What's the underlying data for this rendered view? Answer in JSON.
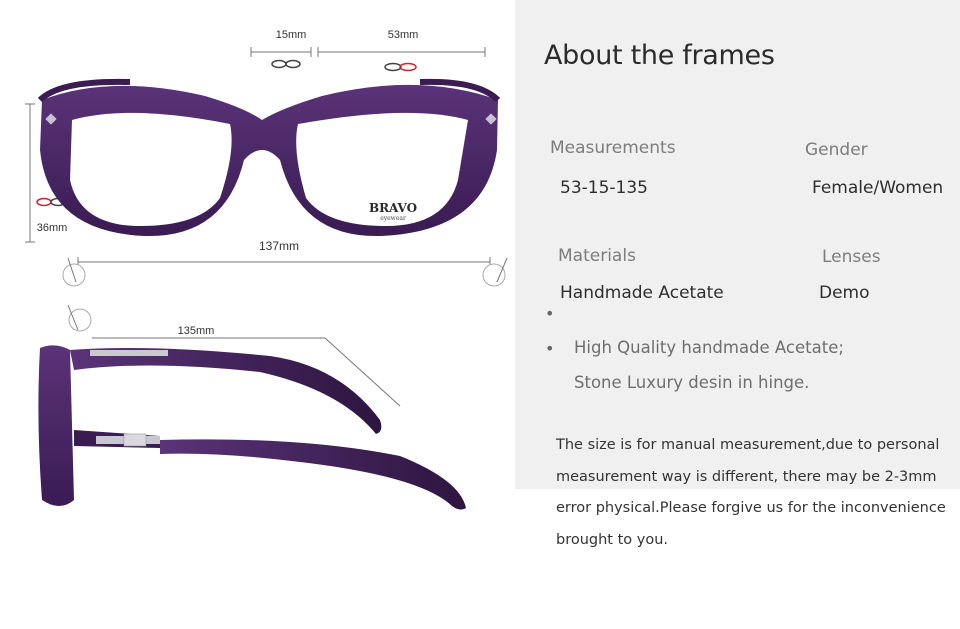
{
  "measurements_diagram": {
    "bridge_width": "15mm",
    "lens_width": "53mm",
    "lens_height": "36mm",
    "frame_width": "137mm",
    "temple_length": "135mm",
    "brand_logo": "BRAVO",
    "brand_sub": "eyewear"
  },
  "info": {
    "title": "About the frames",
    "specs": [
      {
        "label": "Measurements",
        "value": "53-15-135"
      },
      {
        "label": "Gender",
        "value": "Female/Women"
      },
      {
        "label": "Materials",
        "value": "Handmade Acetate"
      },
      {
        "label": "Lenses",
        "value": "Demo"
      }
    ],
    "features": [
      "",
      "High Quality handmade Acetate;",
      "Stone Luxury desin in hinge."
    ],
    "note_lines": [
      "The size is for manual measurement,due to personal",
      "measurement way is different, there may be 2-3mm",
      "error physical.Please forgive us for the inconvenience",
      "brought to you."
    ]
  },
  "colors": {
    "frame_purple": "#4a2763",
    "frame_dark": "#2e1540",
    "panel_bg": "#f0f0f0"
  }
}
